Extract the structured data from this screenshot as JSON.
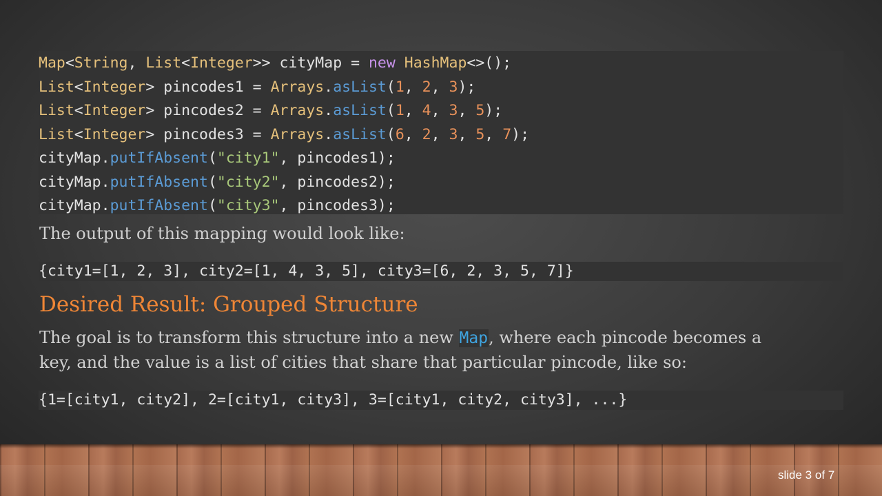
{
  "colors": {
    "heading": "#ef8636",
    "inline_code": "#3fa4e0",
    "code_type": "#e5c07b",
    "code_keyword": "#c792ea",
    "code_method": "#5b9bd5",
    "code_number": "#e8915a",
    "code_string": "#a9c97a"
  },
  "code_lines": [
    [
      {
        "t": "Map",
        "k": "type"
      },
      {
        "t": "<",
        "k": "plain"
      },
      {
        "t": "String",
        "k": "type"
      },
      {
        "t": ", ",
        "k": "plain"
      },
      {
        "t": "List",
        "k": "type"
      },
      {
        "t": "<",
        "k": "plain"
      },
      {
        "t": "Integer",
        "k": "type"
      },
      {
        "t": ">> cityMap = ",
        "k": "plain"
      },
      {
        "t": "new",
        "k": "kw"
      },
      {
        "t": " ",
        "k": "plain"
      },
      {
        "t": "HashMap",
        "k": "type"
      },
      {
        "t": "<>();",
        "k": "plain"
      }
    ],
    [
      {
        "t": "List",
        "k": "type"
      },
      {
        "t": "<",
        "k": "plain"
      },
      {
        "t": "Integer",
        "k": "type"
      },
      {
        "t": "> pincodes1 = ",
        "k": "plain"
      },
      {
        "t": "Arrays",
        "k": "type"
      },
      {
        "t": ".",
        "k": "plain"
      },
      {
        "t": "asList",
        "k": "method"
      },
      {
        "t": "(",
        "k": "plain"
      },
      {
        "t": "1",
        "k": "num"
      },
      {
        "t": ", ",
        "k": "plain"
      },
      {
        "t": "2",
        "k": "num"
      },
      {
        "t": ", ",
        "k": "plain"
      },
      {
        "t": "3",
        "k": "num"
      },
      {
        "t": ");",
        "k": "plain"
      }
    ],
    [
      {
        "t": "List",
        "k": "type"
      },
      {
        "t": "<",
        "k": "plain"
      },
      {
        "t": "Integer",
        "k": "type"
      },
      {
        "t": "> pincodes2 = ",
        "k": "plain"
      },
      {
        "t": "Arrays",
        "k": "type"
      },
      {
        "t": ".",
        "k": "plain"
      },
      {
        "t": "asList",
        "k": "method"
      },
      {
        "t": "(",
        "k": "plain"
      },
      {
        "t": "1",
        "k": "num"
      },
      {
        "t": ", ",
        "k": "plain"
      },
      {
        "t": "4",
        "k": "num"
      },
      {
        "t": ", ",
        "k": "plain"
      },
      {
        "t": "3",
        "k": "num"
      },
      {
        "t": ", ",
        "k": "plain"
      },
      {
        "t": "5",
        "k": "num"
      },
      {
        "t": ");",
        "k": "plain"
      }
    ],
    [
      {
        "t": "List",
        "k": "type"
      },
      {
        "t": "<",
        "k": "plain"
      },
      {
        "t": "Integer",
        "k": "type"
      },
      {
        "t": "> pincodes3 = ",
        "k": "plain"
      },
      {
        "t": "Arrays",
        "k": "type"
      },
      {
        "t": ".",
        "k": "plain"
      },
      {
        "t": "asList",
        "k": "method"
      },
      {
        "t": "(",
        "k": "plain"
      },
      {
        "t": "6",
        "k": "num"
      },
      {
        "t": ", ",
        "k": "plain"
      },
      {
        "t": "2",
        "k": "num"
      },
      {
        "t": ", ",
        "k": "plain"
      },
      {
        "t": "3",
        "k": "num"
      },
      {
        "t": ", ",
        "k": "plain"
      },
      {
        "t": "5",
        "k": "num"
      },
      {
        "t": ", ",
        "k": "plain"
      },
      {
        "t": "7",
        "k": "num"
      },
      {
        "t": ");",
        "k": "plain"
      }
    ],
    [
      {
        "t": "cityMap.",
        "k": "plain"
      },
      {
        "t": "putIfAbsent",
        "k": "method"
      },
      {
        "t": "(",
        "k": "plain"
      },
      {
        "t": "\"city1\"",
        "k": "str"
      },
      {
        "t": ", pincodes1);",
        "k": "plain"
      }
    ],
    [
      {
        "t": "cityMap.",
        "k": "plain"
      },
      {
        "t": "putIfAbsent",
        "k": "method"
      },
      {
        "t": "(",
        "k": "plain"
      },
      {
        "t": "\"city2\"",
        "k": "str"
      },
      {
        "t": ", pincodes2);",
        "k": "plain"
      }
    ],
    [
      {
        "t": "cityMap.",
        "k": "plain"
      },
      {
        "t": "putIfAbsent",
        "k": "method"
      },
      {
        "t": "(",
        "k": "plain"
      },
      {
        "t": "\"city3\"",
        "k": "str"
      },
      {
        "t": ", pincodes3);",
        "k": "plain"
      }
    ]
  ],
  "intro_text": "The output of this mapping would look like:",
  "output_code": "{city1=[1, 2, 3], city2=[1, 4, 3, 5], city3=[6, 2, 3, 5, 7]}",
  "heading": "Desired Result: Grouped Structure",
  "goal": {
    "before": "The goal is to transform this structure into a new ",
    "inline_code": "Map",
    "after": ", where each pincode becomes a",
    "line2": "key, and the value is a list of cities that share that particular pincode, like so:"
  },
  "result_code": "{1=[city1, city2], 2=[city1, city3], 3=[city1, city2, city3], ...}",
  "slide_number": "slide 3 of 7"
}
